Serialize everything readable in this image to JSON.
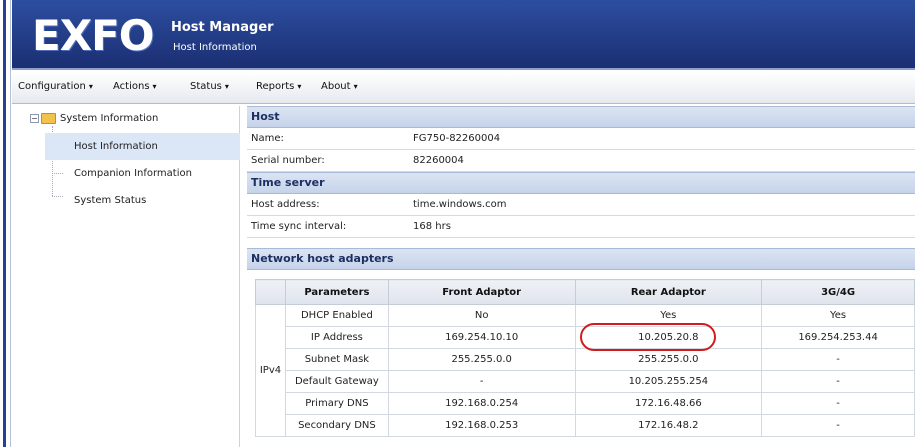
{
  "app": {
    "logo": "EXFO",
    "title": "Host Manager",
    "subtitle": "Host Information"
  },
  "menu": [
    {
      "label": "Configuration"
    },
    {
      "label": "Actions"
    },
    {
      "label": "Status"
    },
    {
      "label": "Reports"
    },
    {
      "label": "About"
    }
  ],
  "tree": {
    "root": "System Information",
    "items": [
      {
        "label": "Host Information",
        "selected": true
      },
      {
        "label": "Companion Information",
        "selected": false
      },
      {
        "label": "System Status",
        "selected": false
      }
    ]
  },
  "host": {
    "header": "Host",
    "rows": [
      {
        "key": "Name:",
        "value": "FG750-82260004"
      },
      {
        "key": "Serial number:",
        "value": "82260004"
      }
    ]
  },
  "time_server": {
    "header": "Time server",
    "rows": [
      {
        "key": "Host address:",
        "value": "time.windows.com"
      },
      {
        "key": "Time sync interval:",
        "value": "168 hrs"
      }
    ]
  },
  "network": {
    "header": "Network host adapters",
    "columns": [
      "Parameters",
      "Front Adaptor",
      "Rear Adaptor",
      "3G/4G"
    ],
    "group": "IPv4",
    "rows": [
      [
        "DHCP Enabled",
        "No",
        "Yes",
        "Yes"
      ],
      [
        "IP Address",
        "169.254.10.10",
        "10.205.20.8",
        "169.254.253.44"
      ],
      [
        "Subnet Mask",
        "255.255.0.0",
        "255.255.0.0",
        "-"
      ],
      [
        "Default Gateway",
        "-",
        "10.205.255.254",
        "-"
      ],
      [
        "Primary DNS",
        "192.168.0.254",
        "172.16.48.66",
        "-"
      ],
      [
        "Secondary DNS",
        "192.168.0.253",
        "172.16.48.2",
        "-"
      ]
    ]
  },
  "colors": {
    "header_bg": "#1b2f72",
    "highlight": "#d11c1c",
    "selected": "#dbe6f7"
  }
}
